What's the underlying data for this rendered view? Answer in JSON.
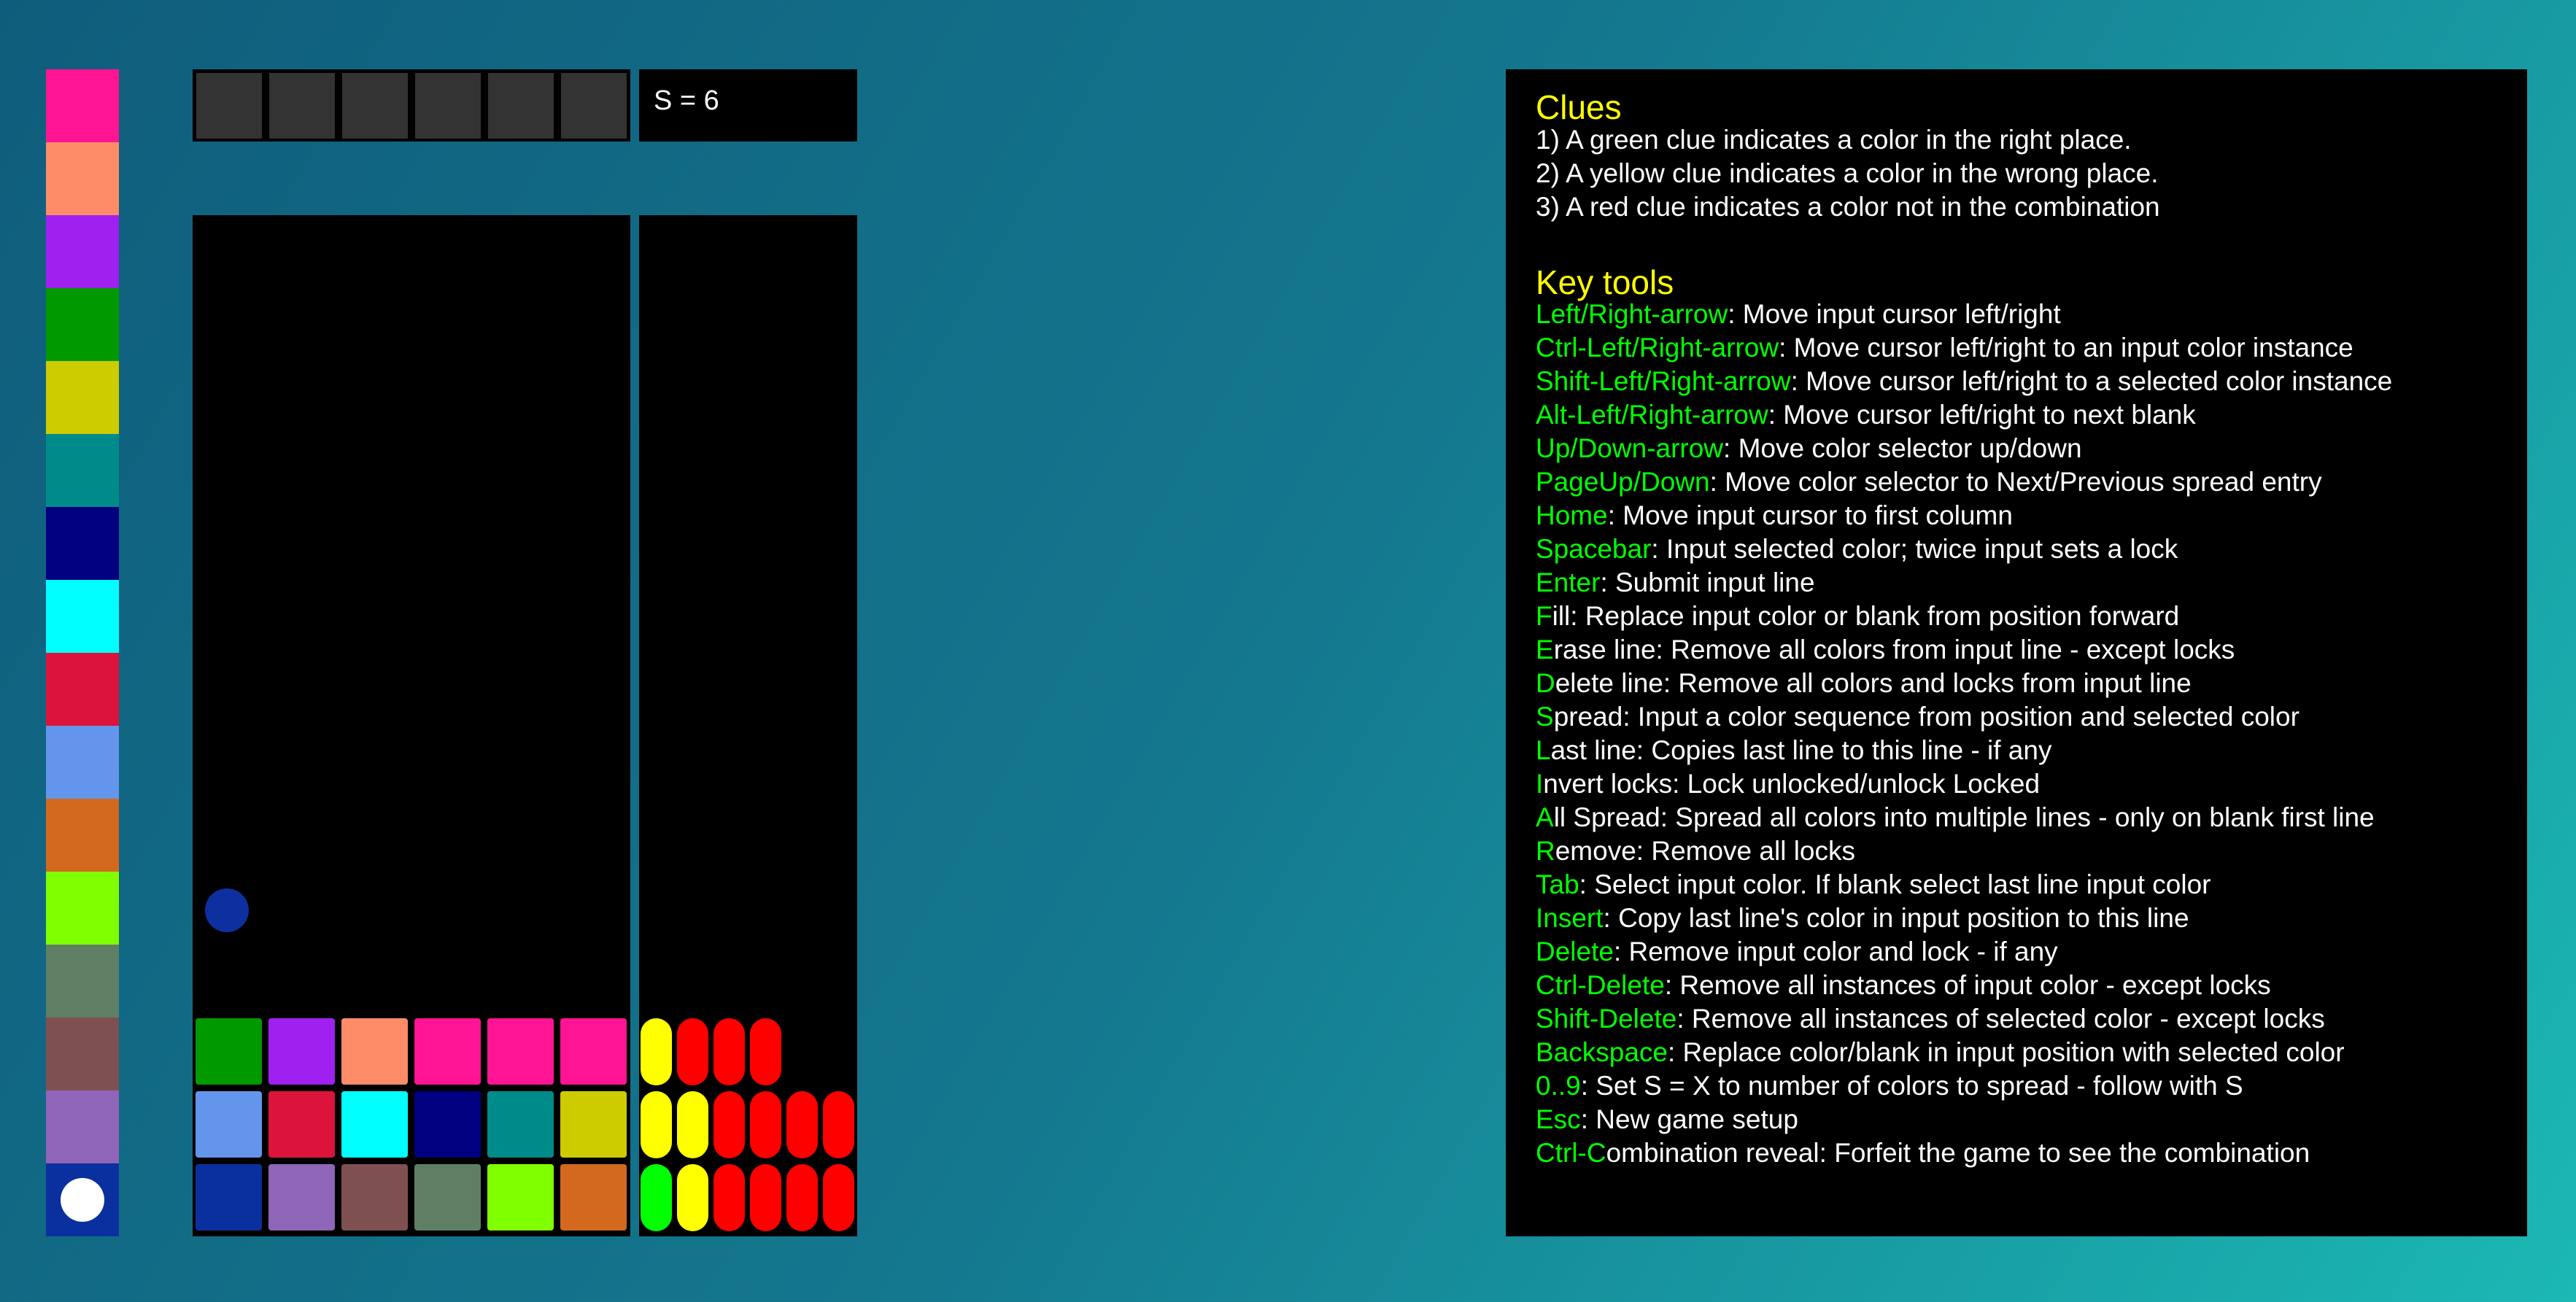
{
  "palette": {
    "colors": [
      "#ff1493",
      "#ff8c69",
      "#a020f0",
      "#009900",
      "#cccc00",
      "#008b8b",
      "#000080",
      "#00ffff",
      "#dc143c",
      "#6495ed",
      "#d2691e",
      "#7fff00",
      "#5f7f65",
      "#7f5052",
      "#8e65b8",
      "#0a309f"
    ]
  },
  "input_row": {
    "cells": [
      "blank",
      "blank",
      "blank",
      "blank",
      "blank",
      "blank"
    ]
  },
  "spread": {
    "label": "S = 6"
  },
  "board": {
    "cursor_color": "#0d2fa0",
    "rows": [
      [
        "#009900",
        "#a020f0",
        "#ff8c69",
        "#ff1493",
        "#ff1493",
        "#ff1493"
      ],
      [
        "#6495ed",
        "#dc143c",
        "#00ffff",
        "#000080",
        "#008b8b",
        "#cccc00"
      ],
      [
        "#0a309f",
        "#8e65b8",
        "#7f5052",
        "#5f7f65",
        "#7fff00",
        "#d2691e"
      ]
    ]
  },
  "clues": {
    "rows": [
      [
        "yellow",
        "red",
        "red",
        "red"
      ],
      [
        "yellow",
        "yellow",
        "red",
        "red",
        "red",
        "red"
      ],
      [
        "green",
        "yellow",
        "red",
        "red",
        "red",
        "red"
      ]
    ],
    "colors": {
      "green": "#00ff00",
      "yellow": "#ffff00",
      "red": "#ff0000"
    }
  },
  "help": {
    "clues_title": "Clues",
    "clue_lines": [
      "1) A green clue indicates a color in the right place.",
      "2) A yellow clue indicates a color in the wrong place.",
      "3) A red clue indicates a color not in the combination"
    ],
    "tools_title": "Key tools",
    "tools": [
      {
        "key": "Left/Right-arrow",
        "desc": ": Move input cursor left/right"
      },
      {
        "key": "Ctrl-Left/Right-arrow",
        "desc": ": Move cursor left/right to an input color instance"
      },
      {
        "key": "Shift-Left/Right-arrow",
        "desc": ": Move cursor left/right to a selected color instance"
      },
      {
        "key": "Alt-Left/Right-arrow",
        "desc": ": Move cursor left/right to next blank"
      },
      {
        "key": "Up/Down-arrow",
        "desc": ": Move color selector up/down"
      },
      {
        "key": "PageUp/Down",
        "desc": ": Move color selector to Next/Previous spread entry"
      },
      {
        "key": "Home",
        "desc": ": Move input cursor to first column"
      },
      {
        "key": "Spacebar",
        "desc": ": Input selected color; twice input sets a lock"
      },
      {
        "key": "Enter",
        "desc": ": Submit input line"
      },
      {
        "key": "F",
        "desc": "ill: Replace input color or blank from position forward"
      },
      {
        "key": "E",
        "desc": "rase line: Remove all colors from input line - except locks"
      },
      {
        "key": "D",
        "desc": "elete line: Remove all colors and locks from input line"
      },
      {
        "key": "S",
        "desc": "pread: Input a color sequence from position and selected color"
      },
      {
        "key": "L",
        "desc": "ast line: Copies last line to this line - if any"
      },
      {
        "key": "I",
        "desc": "nvert locks: Lock unlocked/unlock Locked"
      },
      {
        "key": "A",
        "desc": "ll Spread: Spread all colors into multiple lines - only on blank first line"
      },
      {
        "key": "R",
        "desc": "emove: Remove all locks"
      },
      {
        "key": "Tab",
        "desc": ": Select input color. If blank select last line input color"
      },
      {
        "key": "Insert",
        "desc": ": Copy last line's color in input position to this line"
      },
      {
        "key": "Delete",
        "desc": ": Remove input color and lock - if any"
      },
      {
        "key": "Ctrl-Delete",
        "desc": ": Remove all instances of input color - except locks"
      },
      {
        "key": "Shift-Delete",
        "desc": ": Remove all instances of selected color - except locks"
      },
      {
        "key": "Backspace",
        "desc": ": Replace color/blank in input position with selected color"
      },
      {
        "key": "0..9",
        "desc": ": Set S = X to number of colors to spread - follow with S"
      },
      {
        "key": "Esc",
        "desc": ": New game setup"
      },
      {
        "key": "Ctrl-C",
        "desc": "ombination reveal: Forfeit the game to see the combination"
      }
    ]
  }
}
